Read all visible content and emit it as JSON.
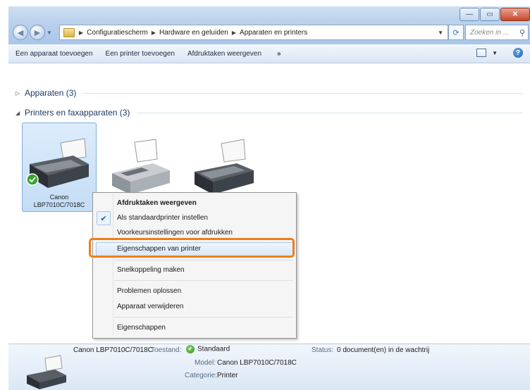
{
  "window": {
    "buttons": {
      "minimize": "—",
      "maximize": "▭",
      "close": "✕"
    }
  },
  "address": {
    "crumbs": [
      "Configuratiescherm",
      "Hardware en geluiden",
      "Apparaten en printers"
    ],
    "search_placeholder": "Zoeken in ..."
  },
  "toolbar": {
    "add_device": "Een apparaat toevoegen",
    "add_printer": "Een printer toevoegen",
    "view_print_jobs": "Afdruktaken weergeven",
    "more": "»"
  },
  "groups": {
    "devices": "Apparaten (3)",
    "printers": "Printers en faxapparaten (3)"
  },
  "devices": {
    "selected_label_line1": "Canon",
    "selected_label_line2": "LBP7010C/7018C"
  },
  "context_menu": {
    "items": [
      "Afdruktaken weergeven",
      "Als standaardprinter instellen",
      "Voorkeursinstellingen voor afdrukken",
      "Eigenschappen van printer",
      "Snelkoppeling maken",
      "Problemen oplossen",
      "Apparaat verwijderen",
      "Eigenschappen"
    ]
  },
  "details": {
    "device_name": "Canon LBP7010C/7018C",
    "state_label": "Toestand:",
    "state_value": "Standaard",
    "status_label": "Status:",
    "status_value": "0 document(en) in de wachtrij",
    "model_label": "Model:",
    "model_value": "Canon LBP7010C/7018C",
    "category_label": "Categorie:",
    "category_value": "Printer"
  }
}
